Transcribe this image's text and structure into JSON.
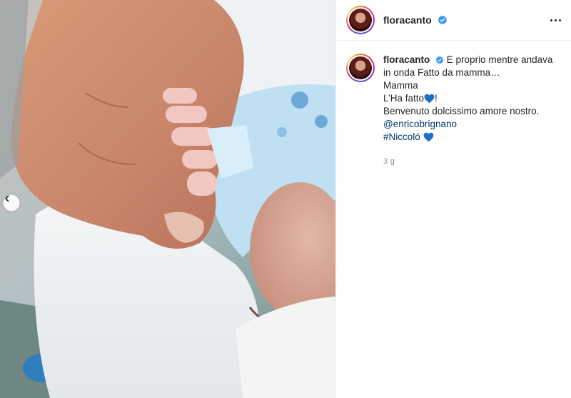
{
  "post": {
    "image_alt": "",
    "username": "floracanto",
    "verified": true
  },
  "caption": {
    "username": "floracanto",
    "line1": "E proprio mentre andava in onda Fatto da mamma…",
    "line2": "Mamma",
    "line3": "L’Ha fatto",
    "line3_suffix": "!",
    "line4": "Benvenuto dolcissimo amore nostro.",
    "mention": "@enricobrignano",
    "hashtag": "#Niccoló",
    "timestamp": "3 g"
  },
  "colors": {
    "verified": "#3897f0",
    "heart": "#1d6fc9",
    "link": "#00376b"
  },
  "icons": {
    "prev": "chevron-left-icon",
    "more": "more-horizontal-icon",
    "verified": "verified-badge-icon",
    "heart": "blue-heart-icon"
  }
}
